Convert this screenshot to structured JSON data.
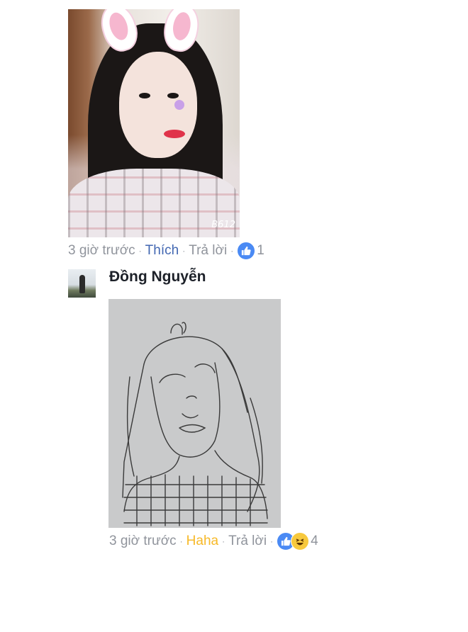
{
  "comment1": {
    "photo_watermark": "B612",
    "time": "3 giờ trước",
    "separator": "·",
    "like_action": "Thích",
    "reply_action": "Trả lời",
    "reaction_icon": "like-icon",
    "reaction_count": "1"
  },
  "comment2": {
    "author": "Đồng Nguyễn",
    "time": "3 giờ trước",
    "separator": "·",
    "reaction_action": "Haha",
    "reply_action": "Trả lời",
    "reaction_icons": [
      "like-icon",
      "haha-icon"
    ],
    "reaction_count": "4"
  },
  "colors": {
    "link_blue": "#4267b2",
    "haha_yellow": "#f7b928",
    "meta_gray": "#90949c",
    "like_blue": "#4a8af4"
  }
}
